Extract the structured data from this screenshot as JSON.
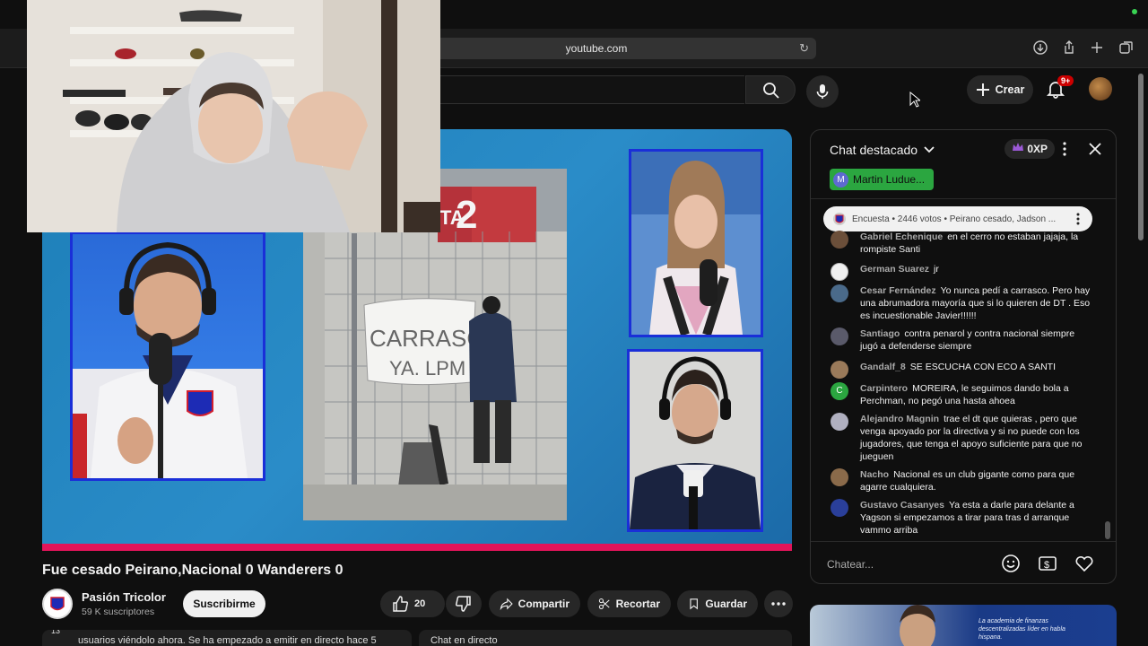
{
  "browser": {
    "url": "youtube.com",
    "icons": [
      "download-icon",
      "share-icon",
      "new-tab-icon",
      "tabs-icon"
    ]
  },
  "header": {
    "create_label": "Crear",
    "notif_count": "9+"
  },
  "video": {
    "title": "Fue cesado Peirano,Nacional 0 Wanderers 0",
    "banner_text": "2",
    "banner_partial": "TA",
    "sign_text": "CARRASCO YA. LPM"
  },
  "channel": {
    "name": "Pasión Tricolor",
    "subscribers": "59 K suscriptores",
    "subscribe_label": "Suscribirme"
  },
  "actions": {
    "like_count": "20",
    "share_label": "Compartir",
    "clip_label": "Recortar",
    "save_label": "Guardar"
  },
  "bottom": {
    "left_text": "usuarios viéndolo ahora. Se ha empezado a emitir en directo hace 5",
    "left_count": "13",
    "right_text": "Chat en directo"
  },
  "chat": {
    "title": "Chat destacado",
    "xp": "0XP",
    "pinned_user": "Martin Ludue...",
    "pinned_initial": "M",
    "poll_text": "Encuesta • 2446 votos • Peirano cesado, Jadson ...",
    "input_placeholder": "Chatear...",
    "messages": [
      {
        "author": "Gabriel Echenique",
        "text": "en el cerro no estaban jajaja, la rompiste Santi",
        "color": "#6b4f3a"
      },
      {
        "author": "German Suarez",
        "text": "jr",
        "color": "#8a8a8a"
      },
      {
        "author": "Cesar Fernández",
        "text": "Yo nunca pedí a carrasco. Pero hay una abrumadora mayoría que si lo quieren de DT . Eso es incuestionable Javier!!!!!!",
        "color": "#4a6a8a"
      },
      {
        "author": "Santiago",
        "text": "contra penarol y contra nacional siempre jugó a defenderse siempre",
        "color": "#5a5a6a"
      },
      {
        "author": "Gandalf_8",
        "text": "SE ESCUCHA CON ECO A SANTI",
        "color": "#9a7a5a"
      },
      {
        "author": "Carpintero",
        "text": "MOREIRA, le seguimos dando bola a Perchman, no pegó una hasta ahoea",
        "color": "#2ba640",
        "initial": "C"
      },
      {
        "author": "Alejandro Magnin",
        "text": "trae el dt que quieras , pero que venga apoyado por la directiva y si no puede con los jugadores, que tenga el apoyo suficiente para que no jueguen",
        "color": "#b0b0c0"
      },
      {
        "author": "Nacho",
        "text": "Nacional es un club gigante como para que agarre cualquiera.",
        "color": "#8a6a4a"
      },
      {
        "author": "Gustavo Casanyes",
        "text": "Ya esta a darle para delante a Yagson si empezamos a tirar para tras d arranque vammo arriba",
        "color": "#2a3f9a"
      }
    ]
  },
  "ad": {
    "text": "La academia de finanzas descentralizadas líder en habla hispana."
  }
}
